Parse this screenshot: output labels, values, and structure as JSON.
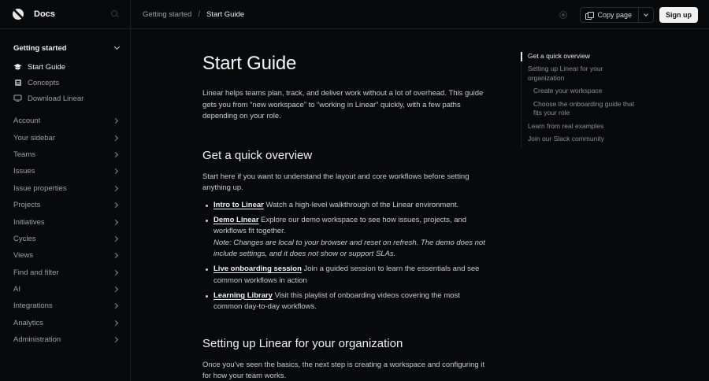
{
  "sidebar": {
    "title": "Docs",
    "group": "Getting started",
    "subitems": [
      {
        "label": "Start Guide",
        "icon": "graduation-cap-icon"
      },
      {
        "label": "Concepts",
        "icon": "book-icon"
      },
      {
        "label": "Download Linear",
        "icon": "monitor-icon"
      }
    ],
    "sections": [
      "Account",
      "Your sidebar",
      "Teams",
      "Issues",
      "Issue properties",
      "Projects",
      "Initiatives",
      "Cycles",
      "Views",
      "Find and filter",
      "AI",
      "Integrations",
      "Analytics",
      "Administration"
    ]
  },
  "topbar": {
    "breadcrumb_parent": "Getting started",
    "breadcrumb_sep": "/",
    "breadcrumb_current": "Start Guide",
    "copy_label": "Copy page",
    "signup_label": "Sign up"
  },
  "main": {
    "title": "Start Guide",
    "intro": "Linear helps teams plan, track, and deliver work without a lot of overhead. This guide gets you from “new workspace” to “working in Linear” quickly, with a few paths depending on your role.",
    "overview_heading": "Get a quick overview",
    "overview_lead": "Start here if you want to understand the layout and core workflows before setting anything up.",
    "bullets": [
      {
        "link": "Intro to Linear",
        "text": " Watch a high-level walkthrough of the Linear environment."
      },
      {
        "link": "Demo Linear",
        "text": " Explore our demo workspace to see how issues, projects, and workflows fit together.",
        "note": "Note: Changes are local to your browser and reset on refresh. The demo does not include settings, and it does not show or support SLAs."
      },
      {
        "link": "Live onboarding session",
        "text": " Join a guided session to learn the essentials and see common workflows in action"
      },
      {
        "link": "Learning Library",
        "text": " Visit this playlist of onboarding videos covering the most common day-to-day workflows."
      }
    ],
    "setup_heading": "Setting up Linear for your organization",
    "setup_text": "Once you’ve seen the basics, the next step is creating a workspace and configuring it for how your team works."
  },
  "toc": {
    "items": [
      {
        "label": "Get a quick overview",
        "active": true,
        "sub": false
      },
      {
        "label": "Setting up Linear for your organization",
        "active": false,
        "sub": false
      },
      {
        "label": "Create your workspace",
        "active": false,
        "sub": true
      },
      {
        "label": "Choose the onboarding guide that fits your role",
        "active": false,
        "sub": true
      },
      {
        "label": "Learn from real examples",
        "active": false,
        "sub": false
      },
      {
        "label": "Join our Slack community",
        "active": false,
        "sub": false
      }
    ]
  },
  "colors": {
    "background": "#08090a",
    "text": "#c9cbcf",
    "heading": "#f5f5f5",
    "muted": "#9ca0a7",
    "button_bg": "#f2f2f2"
  }
}
